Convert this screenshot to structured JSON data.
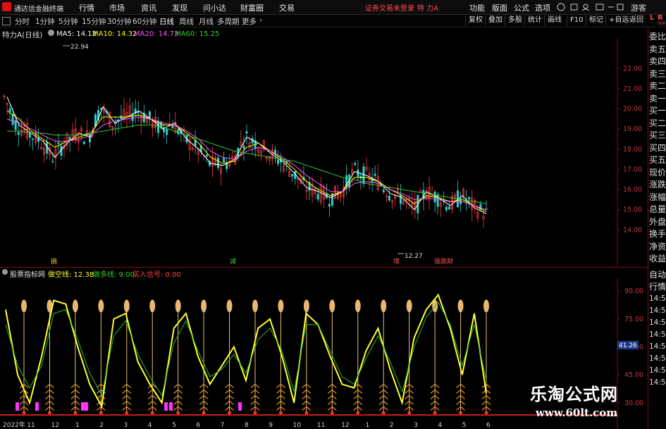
{
  "titlebar": {
    "app_title": "通达信金融终端",
    "menus": [
      "行情",
      "市场",
      "资讯",
      "发现",
      "问小达",
      "财富圈",
      "交易"
    ],
    "trade_status": "证券交易未登录",
    "stock_name": "特 力A",
    "right_menus": [
      "功能",
      "版面",
      "公式",
      "选项"
    ],
    "guest": "游客"
  },
  "toolbar": {
    "tabs": [
      "分时",
      "1分钟",
      "5分钟",
      "15分钟",
      "30分钟",
      "60分钟",
      "日线",
      "周线",
      "月线",
      "多周期",
      "更多"
    ],
    "active_tab": "日线",
    "buttons": [
      "复权",
      "叠加",
      "多股",
      "统计",
      "画线",
      "F10",
      "标记",
      "+自选",
      "返回"
    ]
  },
  "main_chart": {
    "stock_label": "特力A(日线)",
    "ma5": "MA5: 14.12",
    "ma10": "MA10: 14.32",
    "ma20": "MA20: 14.73",
    "ma60": "MA60: 15.25",
    "colors": {
      "ma5": "#ffffff",
      "ma10": "#ffff00",
      "ma20": "#ff55ff",
      "ma60": "#33cc33",
      "axis": "#c23b3b"
    },
    "high_label": "22.94",
    "low_label": "12.27",
    "event_labels": [
      {
        "text": "摘",
        "color": "#e0c040"
      },
      {
        "text": "减",
        "color": "#33cc33"
      },
      {
        "text": "增",
        "color": "#ff5555"
      },
      {
        "text": "涨跌财",
        "color": "#ff5555"
      }
    ]
  },
  "indicator": {
    "title": "股票指标网",
    "line1": "做空线: 12.38",
    "line2": "做多线: 9.00",
    "signal": "买入信号: 0.00",
    "current_value": "41.26"
  },
  "right_panel": {
    "top_tags": [
      "L",
      "R"
    ],
    "tiny": "000",
    "items": [
      "委比",
      "卖五",
      "卖四",
      "卖三",
      "卖二",
      "卖一",
      "买一",
      "买二",
      "买三",
      "买四",
      "买五",
      "现价",
      "涨跌",
      "涨幅",
      "总量",
      "外盘",
      "换手",
      "净资",
      "收益"
    ],
    "bottom_items": [
      "自动",
      "行情",
      "14:5",
      "14:5",
      "14:5",
      "14:5",
      "14:5",
      "14:5",
      "14:5",
      "14:5"
    ]
  },
  "chart_data": [
    {
      "type": "line",
      "title": "特力A(日线)",
      "ylim": [
        13,
        23.2
      ],
      "yticks": [
        "22.00",
        "21.00",
        "20.00",
        "19.00",
        "18.00",
        "17.00",
        "16.00",
        "15.00",
        "14.00"
      ],
      "x_labels": [],
      "series": [
        {
          "name": "MA5",
          "values": [
            20.6,
            19.2,
            18.8,
            18.4,
            17.6,
            18.3,
            18.8,
            18.6,
            20.1,
            19.3,
            19.6,
            19.9,
            19.5,
            19.0,
            19.3,
            18.5,
            18.0,
            17.3,
            17.2,
            17.5,
            18.6,
            18.3,
            17.8,
            17.4,
            16.8,
            16.1,
            15.9,
            15.6,
            15.9,
            16.9,
            16.7,
            16.4,
            15.8,
            15.6,
            15.0,
            15.9,
            15.6,
            15.2,
            15.7,
            15.1,
            14.8
          ]
        },
        {
          "name": "MA10",
          "values": [
            19.9,
            19.5,
            18.9,
            18.5,
            18.1,
            18.4,
            18.6,
            18.8,
            19.6,
            19.6,
            19.6,
            19.7,
            19.5,
            19.2,
            19.2,
            18.8,
            18.3,
            17.6,
            17.3,
            17.4,
            18.1,
            18.3,
            17.9,
            17.5,
            17.0,
            16.4,
            16.0,
            15.7,
            15.9,
            16.6,
            16.6,
            16.4,
            16.0,
            15.7,
            15.3,
            15.7,
            15.6,
            15.4,
            15.5,
            15.2,
            14.9
          ]
        },
        {
          "name": "MA20",
          "values": [
            19.5,
            19.3,
            19.0,
            18.7,
            18.4,
            18.4,
            18.5,
            18.7,
            19.2,
            19.4,
            19.5,
            19.6,
            19.5,
            19.3,
            19.2,
            18.9,
            18.5,
            17.9,
            17.6,
            17.5,
            17.9,
            18.1,
            17.9,
            17.6,
            17.2,
            16.7,
            16.3,
            15.9,
            15.9,
            16.3,
            16.4,
            16.3,
            16.0,
            15.8,
            15.5,
            15.6,
            15.5,
            15.4,
            15.4,
            15.2,
            15.0
          ]
        },
        {
          "name": "MA60",
          "values": [
            18.9,
            18.9,
            18.8,
            18.8,
            18.7,
            18.7,
            18.7,
            18.8,
            18.9,
            19.0,
            19.1,
            19.2,
            19.2,
            19.1,
            18.9,
            18.7,
            18.5,
            18.3,
            18.1,
            17.9,
            17.8,
            17.7,
            17.6,
            17.5,
            17.4,
            17.2,
            17.0,
            16.8,
            16.6,
            16.5,
            16.3,
            16.2,
            16.1,
            16.0,
            15.9,
            15.8,
            15.7,
            15.6,
            15.5,
            15.4,
            15.3
          ]
        }
      ]
    },
    {
      "type": "line",
      "title": "股票指标网",
      "ylim": [
        25,
        95
      ],
      "yticks": [
        "90.00",
        "75.00",
        "60.00",
        "45.00",
        "30.00"
      ],
      "x_labels": [
        "2022年",
        "11",
        "12",
        "1",
        "2",
        "3",
        "4",
        "5",
        "6",
        "7",
        "8",
        "9",
        "10",
        "11",
        "12",
        "1",
        "2",
        "3",
        "4",
        "5",
        "6"
      ],
      "series": [
        {
          "name": "做空线",
          "values": [
            80,
            45,
            30,
            55,
            85,
            83,
            60,
            40,
            28,
            75,
            78,
            52,
            40,
            30,
            70,
            78,
            55,
            40,
            50,
            60,
            42,
            70,
            75,
            55,
            30,
            78,
            72,
            55,
            40,
            38,
            58,
            70,
            48,
            30,
            65,
            80,
            88,
            70,
            45,
            78,
            35
          ]
        },
        {
          "name": "做多线",
          "values": [
            72,
            50,
            38,
            50,
            78,
            80,
            64,
            46,
            34,
            66,
            74,
            56,
            44,
            34,
            62,
            74,
            58,
            44,
            48,
            56,
            46,
            64,
            70,
            58,
            36,
            72,
            72,
            58,
            44,
            40,
            54,
            66,
            52,
            36,
            60,
            76,
            84,
            72,
            50,
            72,
            42
          ]
        }
      ],
      "signal_markers": 19
    }
  ]
}
